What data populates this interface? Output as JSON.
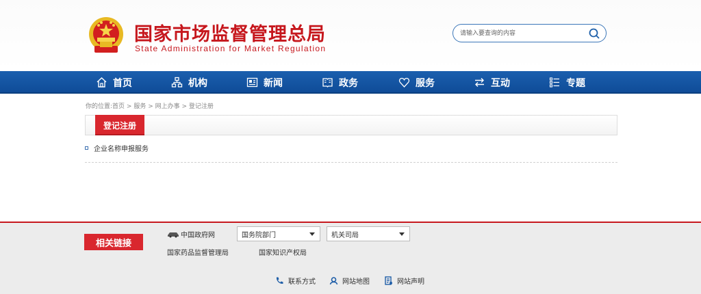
{
  "header": {
    "title_cn": "国家市场监督管理总局",
    "title_en": "State Administration for Market Regulation",
    "search_placeholder": "请输入要查询的内容",
    "brand_color": "#c6171d"
  },
  "nav": {
    "items": [
      {
        "label": "首页",
        "icon": "home-icon"
      },
      {
        "label": "机构",
        "icon": "org-chart-icon"
      },
      {
        "label": "新闻",
        "icon": "news-icon"
      },
      {
        "label": "政务",
        "icon": "book-icon"
      },
      {
        "label": "服务",
        "icon": "heart-icon"
      },
      {
        "label": "互动",
        "icon": "exchange-icon"
      },
      {
        "label": "专题",
        "icon": "list-icon"
      }
    ],
    "color": "#15559f"
  },
  "breadcrumb": {
    "prefix": "你的位置:",
    "items": [
      "首页",
      "服务",
      "网上办事",
      "登记注册"
    ],
    "separator": " > "
  },
  "panel": {
    "tab_label": "登记注册",
    "items": [
      "企业名称申报服务"
    ]
  },
  "footer": {
    "related_label": "相关链接",
    "gov_link": "中国政府网",
    "selects": [
      "国务院部门",
      "机关司局"
    ],
    "sub_links": [
      "国家药品监督管理局",
      "国家知识产权局"
    ],
    "bottom_links": [
      {
        "label": "联系方式",
        "icon": "phone-icon"
      },
      {
        "label": "网站地图",
        "icon": "map-pin-icon"
      },
      {
        "label": "网站声明",
        "icon": "document-icon"
      }
    ]
  }
}
